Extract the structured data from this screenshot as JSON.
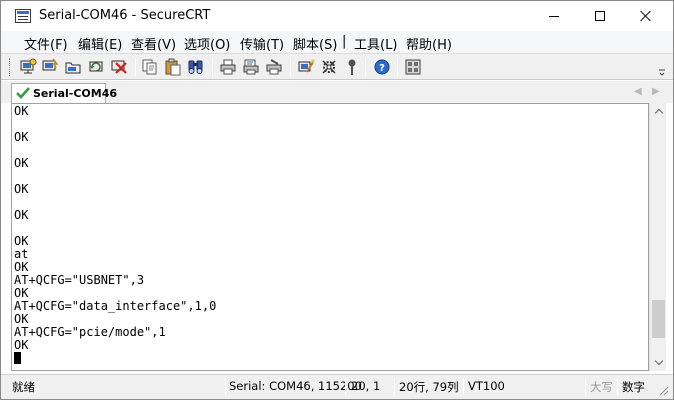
{
  "window": {
    "title": "Serial-COM46 - SecureCRT"
  },
  "menu": {
    "items": [
      "文件(F)",
      "编辑(E)",
      "查看(V)",
      "选项(O)",
      "传输(T)",
      "脚本(S)",
      "工具(L)",
      "帮助(H)"
    ],
    "separator": "|"
  },
  "toolbar": {
    "icons": [
      "connect-icon",
      "quick-connect-icon",
      "connect-in-tab-icon",
      "reconnect-icon",
      "disconnect-icon",
      "copy-icon",
      "paste-icon",
      "find-icon",
      "print-icon",
      "print-selection-icon",
      "print-setup-icon",
      "session-options-icon",
      "global-options-icon",
      "keymap-icon",
      "help-icon",
      "keypad-icon"
    ]
  },
  "tab": {
    "label": "Serial-COM46",
    "status_color": "#2e9e3a"
  },
  "terminal": {
    "lines": [
      "OK",
      "",
      "OK",
      "",
      "OK",
      "",
      "OK",
      "",
      "OK",
      "",
      "OK",
      "at",
      "OK",
      "AT+QCFG=\"USBNET\",3",
      "OK",
      "AT+QCFG=\"data_interface\",1,0",
      "OK",
      "AT+QCFG=\"pcie/mode\",1",
      "OK"
    ],
    "cursor_line": ""
  },
  "scrollbar": {
    "position_fraction": 0.92
  },
  "status": {
    "ready": "就绪",
    "connection": "Serial: COM46, 115200",
    "cursor_pos": "20,  1",
    "size": "20行, 79列",
    "emulation": "VT100",
    "caps": "大写",
    "num": "数字"
  }
}
